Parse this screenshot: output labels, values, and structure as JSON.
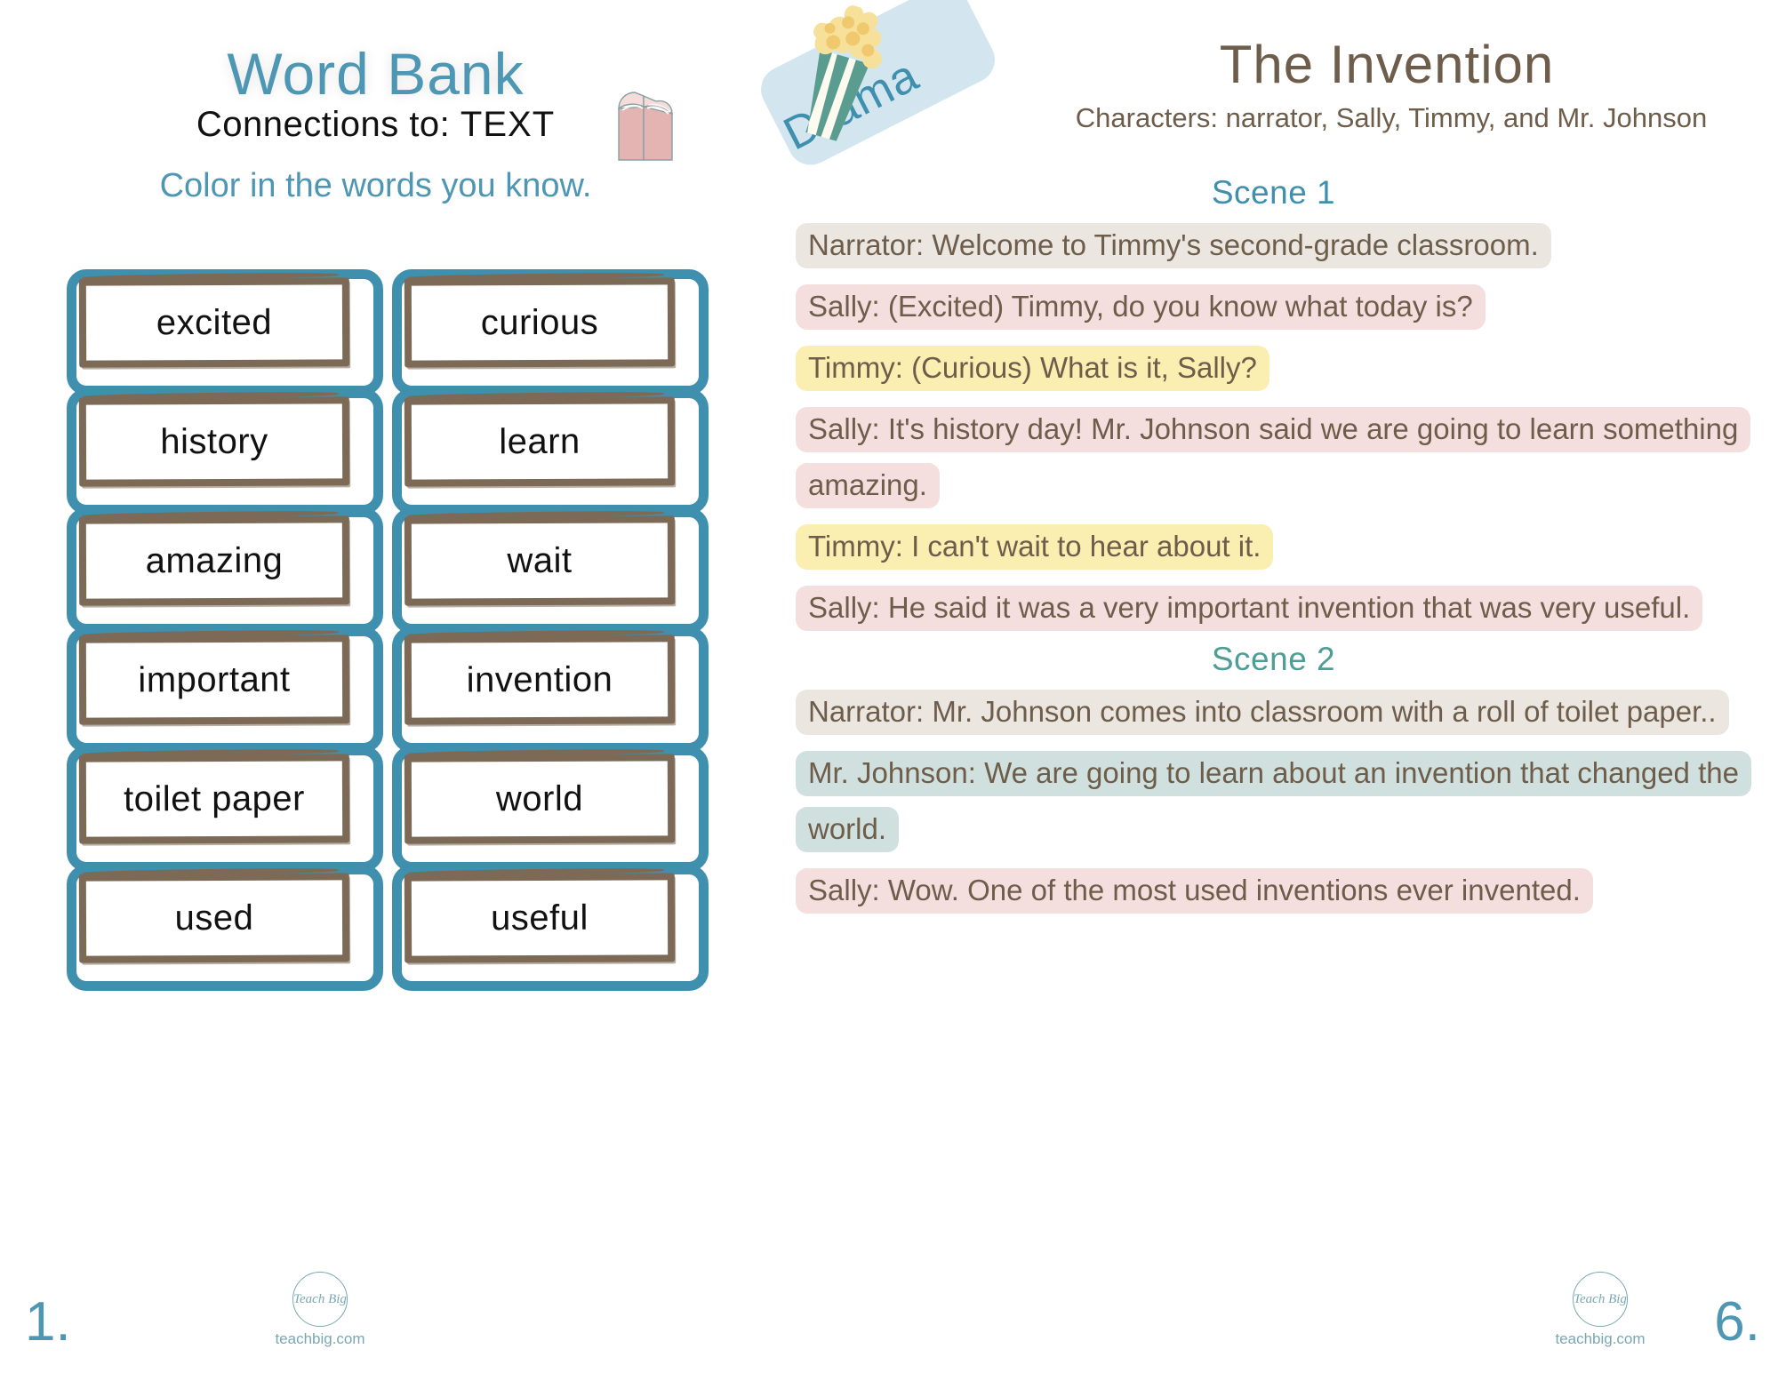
{
  "left_page": {
    "title": "Word Bank",
    "subtitle_prefix": "Connections to:",
    "subtitle_target": "TEXT",
    "instruction": "Color in the words you know.",
    "book_icon": "open-book-icon",
    "words": [
      "excited",
      "curious",
      "history",
      "learn",
      "amazing",
      "wait",
      "important",
      "invention",
      "toilet paper",
      "world",
      "used",
      "useful"
    ],
    "page_number": "1.",
    "brand_mark": "Teach Big",
    "brand_url": "teachbig.com"
  },
  "right_page": {
    "genre_tag": "Drama",
    "genre_icon": "popcorn-icon",
    "title": "The Invention",
    "characters": "Characters: narrator, Sally, Timmy, and Mr. Johnson",
    "scenes": [
      {
        "heading": "Scene 1",
        "heading_color": "#3f8fae",
        "lines": [
          {
            "speaker": "Narrator",
            "highlight": "narrator",
            "color": "#ebe7e0",
            "text": "Narrator: Welcome to Timmy's second-grade classroom."
          },
          {
            "speaker": "Sally",
            "highlight": "sally",
            "color": "#f4dfde",
            "text": "Sally: (Excited) Timmy, do you know what today is?"
          },
          {
            "speaker": "Timmy",
            "highlight": "timmy",
            "color": "#faeeb0",
            "text": "Timmy: (Curious) What is it, Sally?"
          },
          {
            "speaker": "Sally",
            "highlight": "sally",
            "color": "#f4dfde",
            "text": "Sally: It's history day! Mr. Johnson said we are going to learn something amazing."
          },
          {
            "speaker": "Timmy",
            "highlight": "timmy",
            "color": "#faeeb0",
            "text": "Timmy: I can't wait to hear about it."
          },
          {
            "speaker": "Sally",
            "highlight": "sally",
            "color": "#f4dfde",
            "text": "Sally: He said it was a very important invention that was very useful."
          }
        ]
      },
      {
        "heading": "Scene 2",
        "heading_color": "#4f9e96",
        "lines": [
          {
            "speaker": "Narrator",
            "highlight": "narrator",
            "color": "#ebe7e0",
            "text": "Narrator: Mr. Johnson comes into classroom with a roll of toilet paper.."
          },
          {
            "speaker": "Mr. Johnson",
            "highlight": "johnson",
            "color": "#cfe0de",
            "text": "Mr. Johnson: We are going to learn about an invention that changed the world."
          },
          {
            "speaker": "Sally",
            "highlight": "sally",
            "color": "#f4dfde",
            "text": "Sally: Wow. One of the most used inventions ever invented."
          }
        ]
      }
    ],
    "page_number": "6.",
    "brand_mark": "Teach Big",
    "brand_url": "teachbig.com"
  },
  "colors": {
    "accent_blue": "#3f8fae",
    "title_blue": "#4e97b4",
    "brown": "#6d5d4a",
    "card_border_brown": "#7c6a56",
    "tag_bg": "#d3e6ef"
  }
}
